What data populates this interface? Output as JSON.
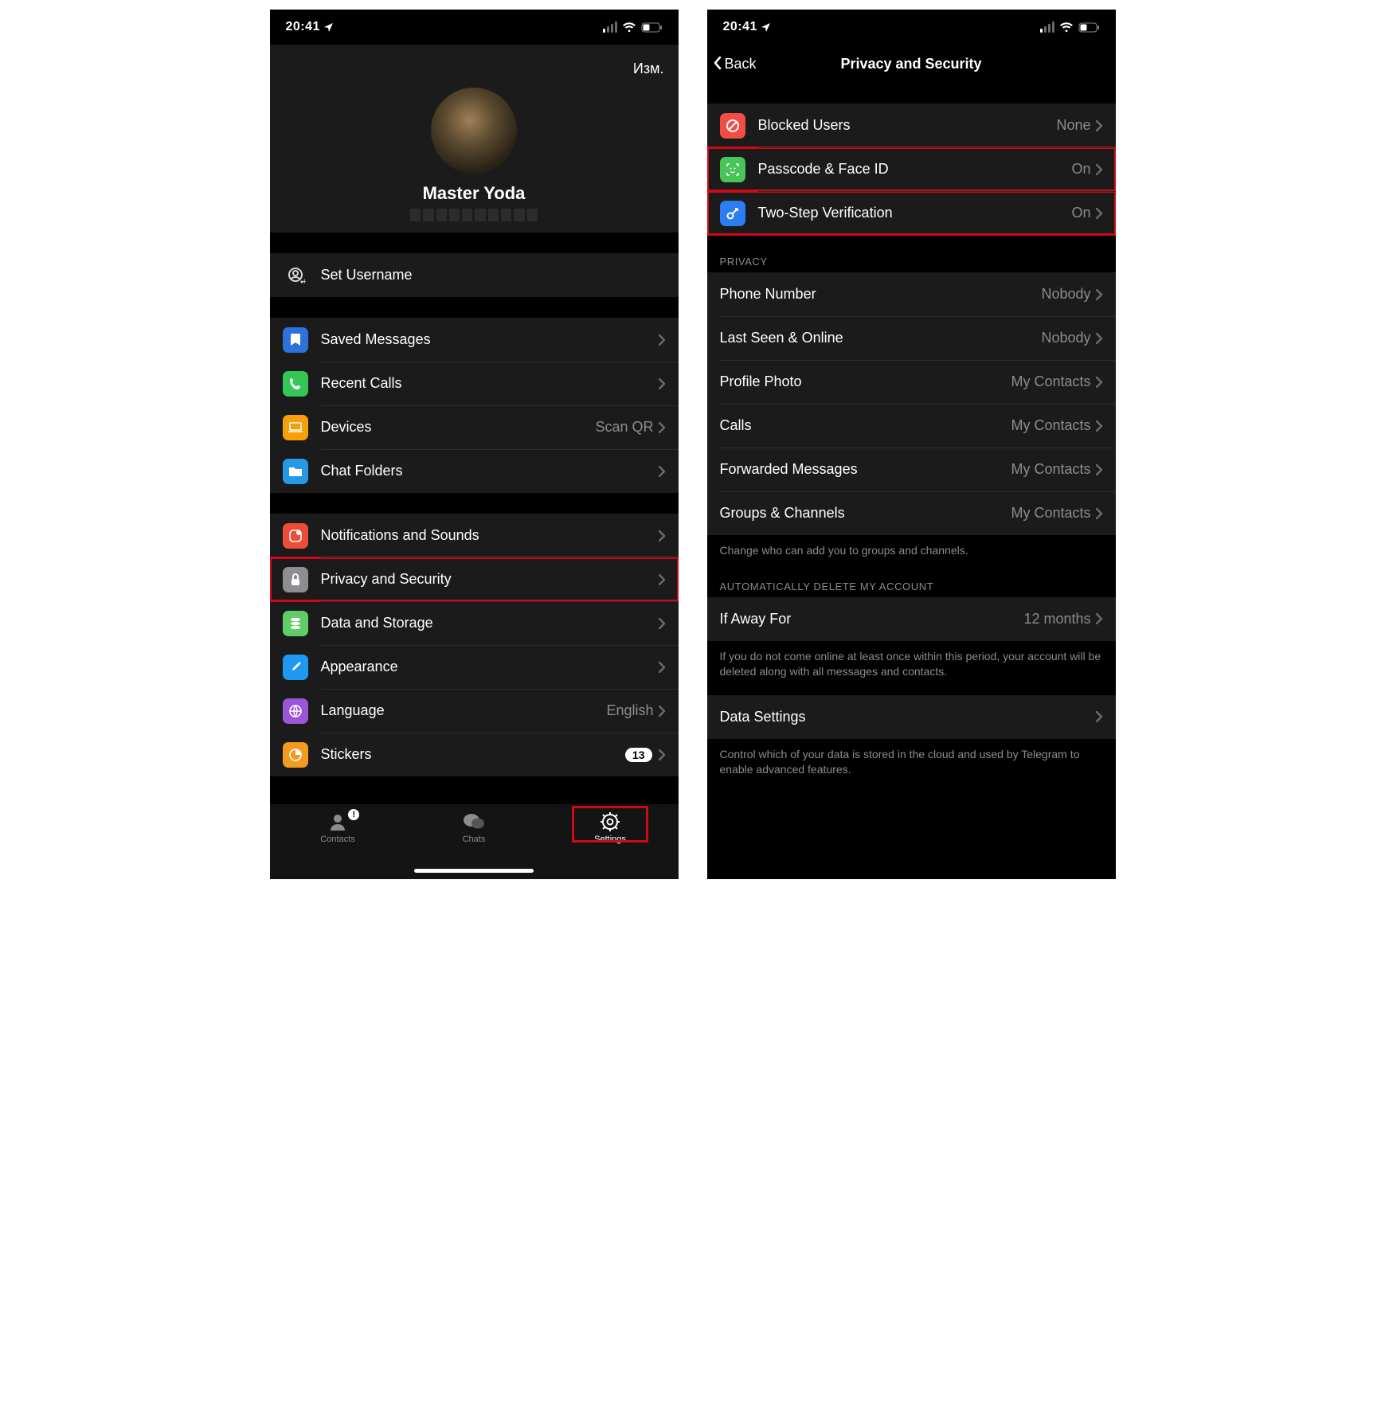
{
  "status": {
    "time": "20:41"
  },
  "left": {
    "edit": "Изм.",
    "display_name": "Master Yoda",
    "rows": {
      "set_username": "Set Username",
      "saved": "Saved Messages",
      "recent": "Recent Calls",
      "devices": "Devices",
      "devices_val": "Scan QR",
      "folders": "Chat Folders",
      "notif": "Notifications and Sounds",
      "privacy": "Privacy and Security",
      "data": "Data and Storage",
      "appearance": "Appearance",
      "language": "Language",
      "language_val": "English",
      "stickers": "Stickers",
      "stickers_badge": "13"
    },
    "tabs": {
      "contacts": "Contacts",
      "chats": "Chats",
      "settings": "Settings",
      "contacts_badge": "!"
    }
  },
  "right": {
    "back": "Back",
    "title": "Privacy and Security",
    "security": {
      "blocked": "Blocked Users",
      "blocked_val": "None",
      "passcode": "Passcode & Face ID",
      "passcode_val": "On",
      "twostep": "Two-Step Verification",
      "twostep_val": "On"
    },
    "privacy_hdr": "PRIVACY",
    "privacy": {
      "phone": "Phone Number",
      "phone_val": "Nobody",
      "lastseen": "Last Seen & Online",
      "lastseen_val": "Nobody",
      "photo": "Profile Photo",
      "photo_val": "My Contacts",
      "calls": "Calls",
      "calls_val": "My Contacts",
      "fwd": "Forwarded Messages",
      "fwd_val": "My Contacts",
      "groups": "Groups & Channels",
      "groups_val": "My Contacts"
    },
    "privacy_foot": "Change who can add you to groups and channels.",
    "auto_hdr": "AUTOMATICALLY DELETE MY ACCOUNT",
    "auto": {
      "away": "If Away For",
      "away_val": "12 months"
    },
    "auto_foot": "If you do not come online at least once within this period, your account will be deleted along with all messages and contacts.",
    "data": {
      "label": "Data Settings"
    },
    "data_foot": "Control which of your data is stored in the cloud and used by Telegram to enable advanced features."
  }
}
